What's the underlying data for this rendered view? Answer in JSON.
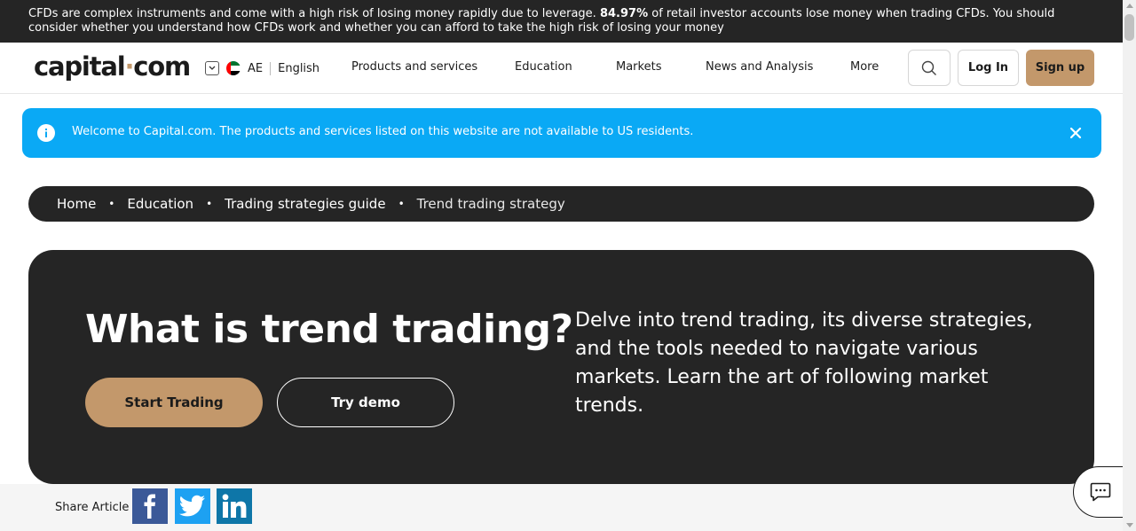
{
  "risk_warning": {
    "text_before": "CFDs are complex instruments and come with a high risk of losing money rapidly due to leverage.",
    "percentage": "84.97%",
    "text_after": "of retail investor accounts lose money when trading CFDs. You should consider whether you understand how CFDs work and whether you can afford to take the high risk of losing your money"
  },
  "header": {
    "logo_left": "capital",
    "logo_dot": "·",
    "logo_right": "com",
    "region_code": "AE",
    "language": "English",
    "nav": [
      "Products and services",
      "Education",
      "Markets",
      "News and Analysis",
      "More"
    ],
    "login_label": "Log In",
    "signup_label": "Sign up"
  },
  "notice": {
    "message": "Welcome to Capital.com. The products and services listed on this website are not available to US residents."
  },
  "breadcrumb": {
    "items": [
      "Home",
      "Education",
      "Trading strategies guide"
    ],
    "current": "Trend trading strategy",
    "separator": "•"
  },
  "hero": {
    "title": "What is trend trading?",
    "description": "Delve into trend trading, its diverse strategies, and the tools needed to navigate various markets. Learn the art of following market trends.",
    "start_label": "Start Trading",
    "demo_label": "Try demo"
  },
  "share": {
    "label": "Share Article",
    "networks": [
      "facebook-icon",
      "twitter-icon",
      "linkedin-icon"
    ]
  },
  "colors": {
    "brand_accent": "#c3986b",
    "dark": "#252525",
    "notice_blue": "#0aa9f5"
  }
}
